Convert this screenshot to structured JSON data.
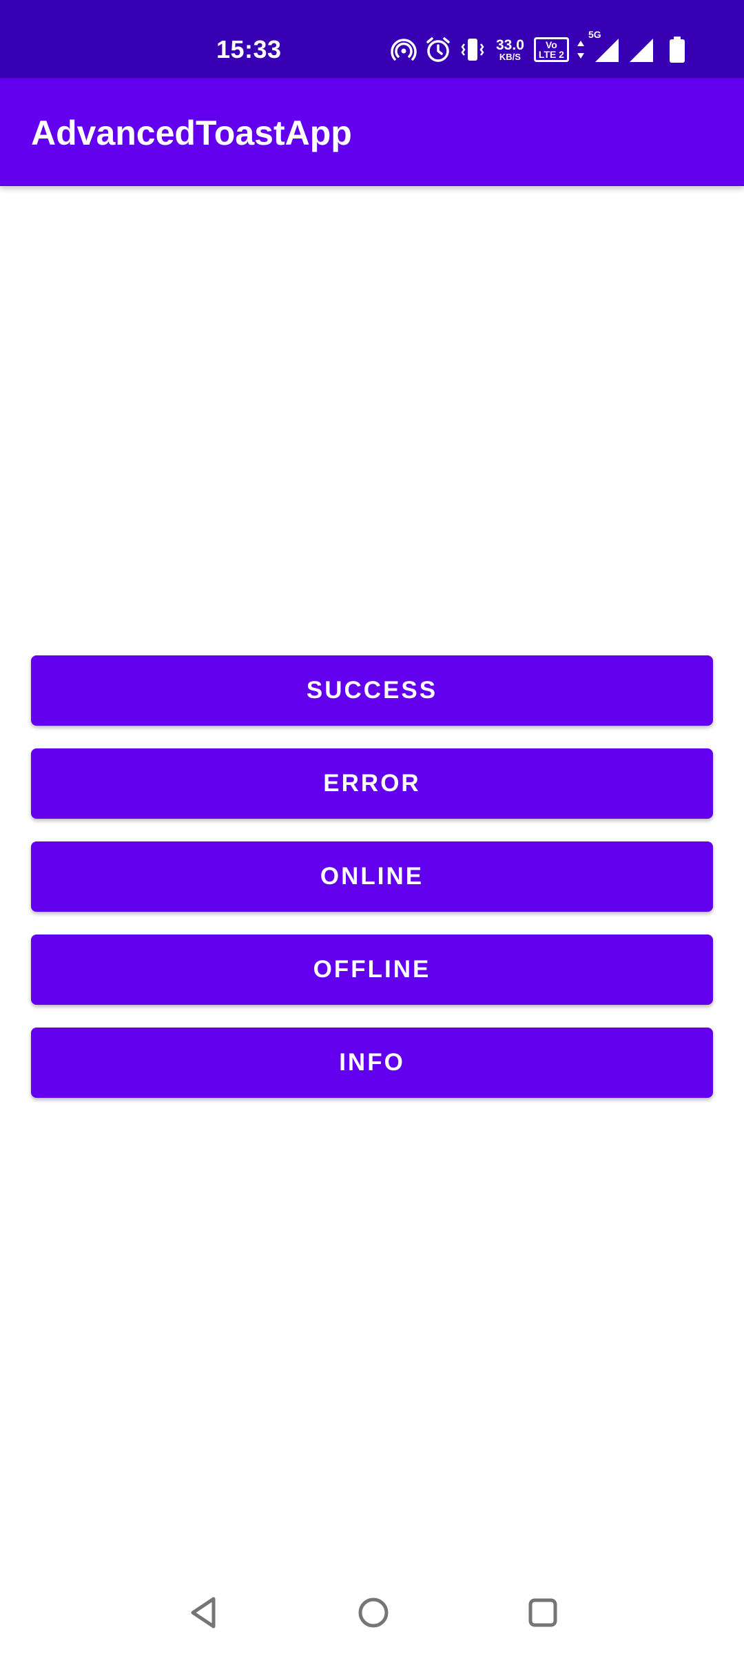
{
  "status_bar": {
    "time": "15:33",
    "net_speed_value": "33.0",
    "net_speed_unit": "KB/S",
    "volte_top": "Vo",
    "volte_bottom": "LTE 2",
    "network_type": "5G",
    "icons": [
      "hotspot-icon",
      "alarm-icon",
      "vibrate-icon",
      "volte-icon",
      "data-arrows-icon",
      "signal-icon",
      "signal-icon",
      "battery-icon"
    ]
  },
  "app_bar": {
    "title": "AdvancedToastApp"
  },
  "buttons": {
    "success": "SUCCESS",
    "error": "ERROR",
    "online": "ONLINE",
    "offline": "OFFLINE",
    "info": "INFO"
  },
  "nav_bar": {
    "icons": [
      "back-icon",
      "home-icon",
      "recents-icon"
    ]
  },
  "colors": {
    "status_bar": "#3700B3",
    "primary": "#6200EE",
    "on_primary": "#FFFFFF",
    "background": "#FFFFFF",
    "nav_icon": "#757575"
  }
}
